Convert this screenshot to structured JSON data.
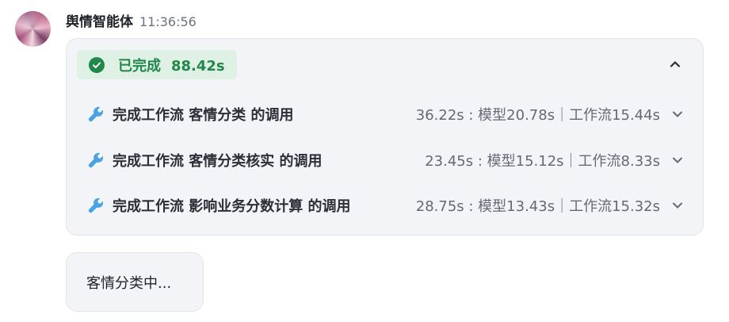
{
  "message": {
    "sender": "舆情智能体",
    "time": "11:36:56",
    "avatar": "avatar-image"
  },
  "card": {
    "status_label": "已完成",
    "status_duration": "88.42s",
    "status_color": "#22874a",
    "status_bg": "#dff1e5",
    "status_icon": "check-circle-icon",
    "collapse_icon": "chevron-up-icon",
    "rows": [
      {
        "icon": "wrench-icon",
        "title": "完成工作流 客情分类 的调用",
        "timing": "36.22s : 模型20.78s｜工作流15.44s",
        "chevron": "chevron-down-icon"
      },
      {
        "icon": "wrench-icon",
        "title": "完成工作流 客情分类核实 的调用",
        "timing": "23.45s : 模型15.12s｜工作流8.33s",
        "chevron": "chevron-down-icon"
      },
      {
        "icon": "wrench-icon",
        "title": "完成工作流 影响业务分数计算 的调用",
        "timing": "28.75s : 模型13.43s｜工作流15.32s",
        "chevron": "chevron-down-icon"
      }
    ]
  },
  "bubble": {
    "text": "客情分类中..."
  },
  "colors": {
    "accent_icon": "#4aa3e0",
    "card_bg": "#f3f4f8",
    "muted_text": "#646a73"
  }
}
